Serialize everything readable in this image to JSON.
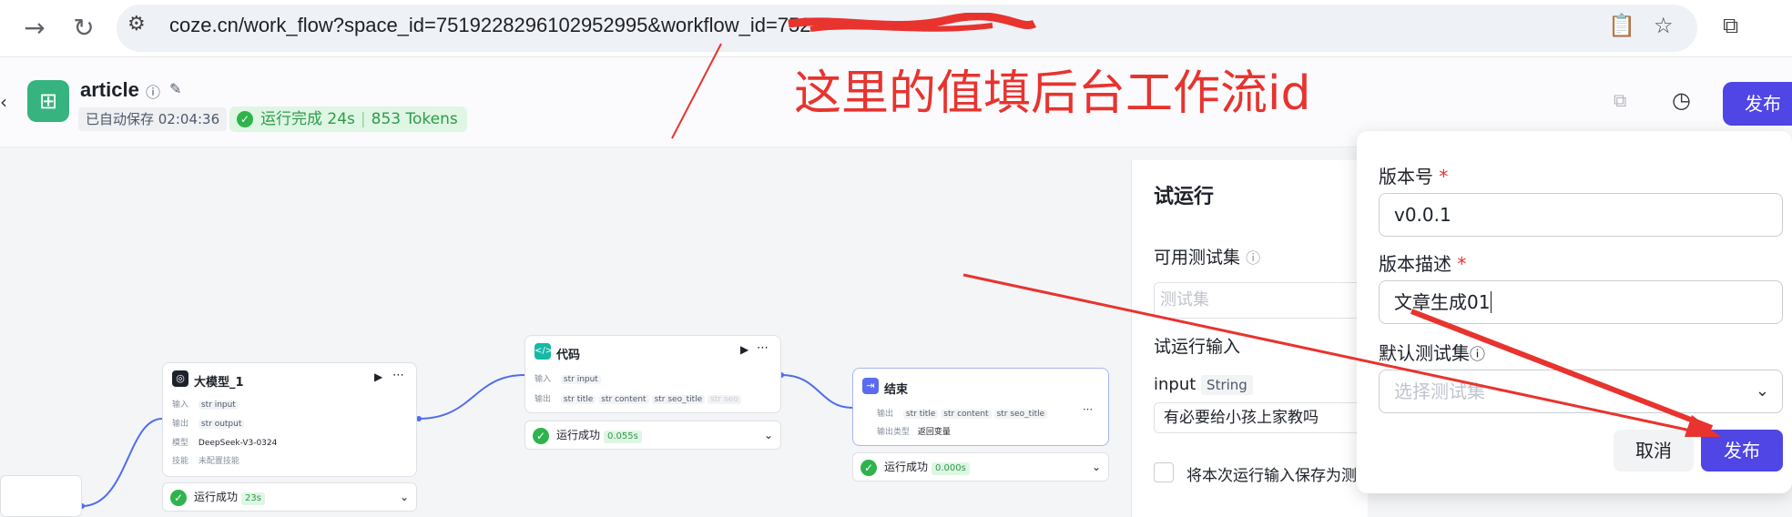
{
  "browser": {
    "url": "coze.cn/work_flow?space_id=7519228296102952995&workflow_id=752"
  },
  "header": {
    "title": "article",
    "saved": "已自动保存 02:04:36",
    "run_status": "运行完成 24s",
    "tokens": "853 Tokens",
    "publish": "发布"
  },
  "annotation": "这里的值填后台工作流id",
  "nodes": {
    "llm": {
      "title": "大模型_1",
      "in_label": "输入",
      "in_val": "input",
      "out_label": "输出",
      "out_val": "output",
      "model_label": "模型",
      "model_val": "DeepSeek-V3-0324",
      "skill_label": "技能",
      "skill_val": "未配置技能",
      "status": "运行成功",
      "time": "23s"
    },
    "code": {
      "title": "代码",
      "in_label": "输入",
      "in_val": "input",
      "out_label": "输出",
      "out_vals": [
        "title",
        "content",
        "seo_title",
        "seo"
      ],
      "status": "运行成功",
      "time": "0.055s"
    },
    "end": {
      "title": "结束",
      "out_label": "输出",
      "out_vals": [
        "title",
        "content",
        "seo_title"
      ],
      "type_label": "输出类型",
      "type_val": "返回变量",
      "status": "运行成功",
      "time": "0.000s"
    },
    "str": "str"
  },
  "trial": {
    "title": "试运行",
    "testset_label": "可用测试集",
    "testset_placeholder": "测试集",
    "input_title": "试运行输入",
    "input_name": "input",
    "input_type": "String",
    "input_value": "有必要给小孩上家教吗",
    "save_label": "将本次运行输入保存为测"
  },
  "dialog": {
    "version_label": "版本号",
    "version_value": "v0.0.1",
    "desc_label": "版本描述",
    "desc_value": "文章生成01",
    "testset_label": "默认测试集",
    "testset_placeholder": "选择测试集",
    "cancel": "取消",
    "publish": "发布"
  }
}
